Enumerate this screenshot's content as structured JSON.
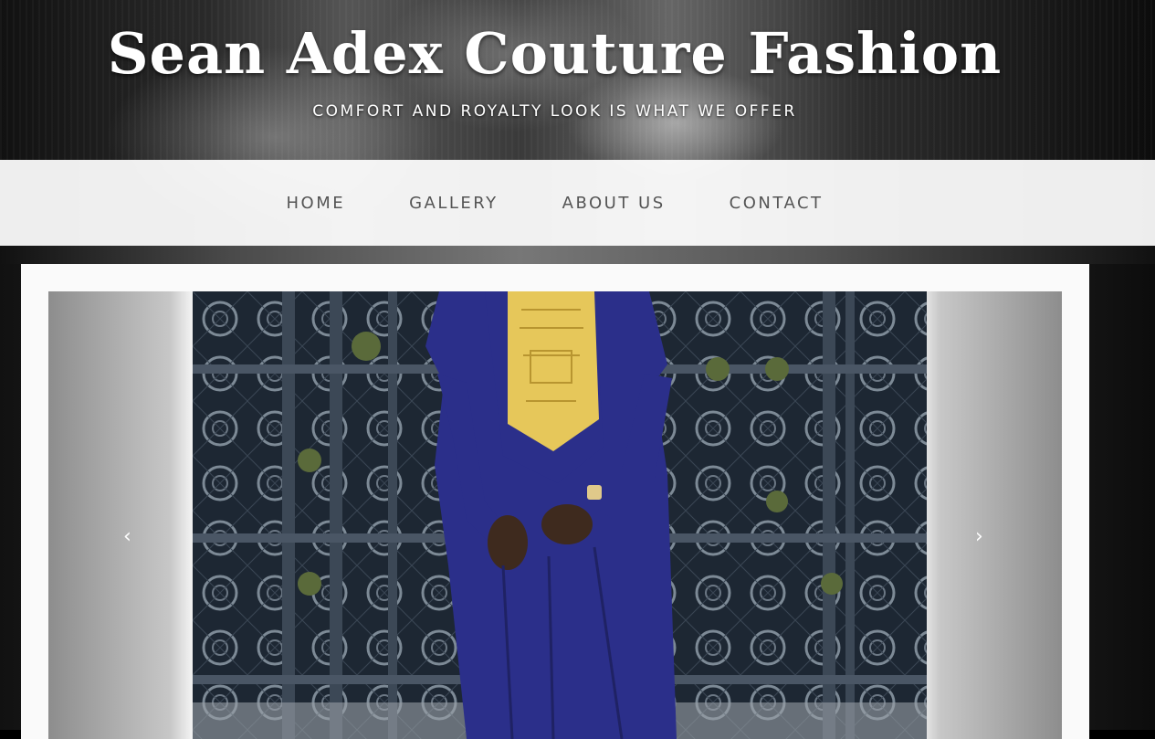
{
  "header": {
    "site_title": "Sean Adex Couture Fashion",
    "tagline": "COMFORT AND ROYALTY LOOK IS WHAT WE OFFER"
  },
  "nav": {
    "items": [
      {
        "label": "HOME"
      },
      {
        "label": "GALLERY"
      },
      {
        "label": "ABOUT US"
      },
      {
        "label": "CONTACT"
      }
    ]
  },
  "slider": {
    "prev_label": "‹",
    "next_label": "›",
    "prev_icon": "chevron-left-icon",
    "next_icon": "chevron-right-icon"
  },
  "colors": {
    "nav_text": "#555555",
    "garment_blue": "#2b2f8a",
    "embroidery_gold": "#e6c75a",
    "gate_dark": "#1d2733"
  }
}
